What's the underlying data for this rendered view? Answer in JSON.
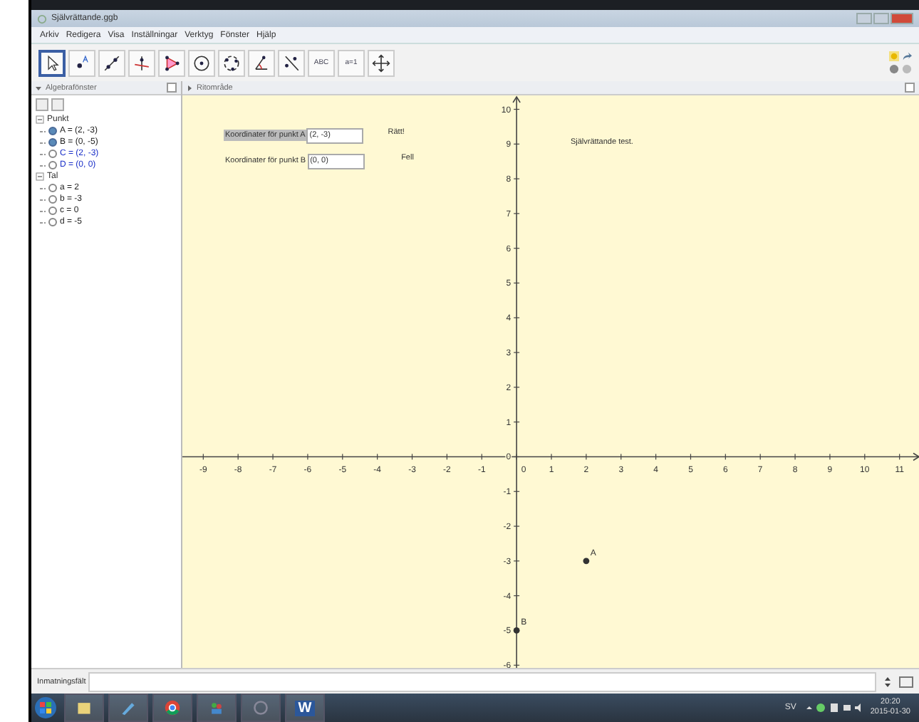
{
  "window": {
    "title": "Självrättande.ggb"
  },
  "menu": [
    "Arkiv",
    "Redigera",
    "Visa",
    "Inställningar",
    "Verktyg",
    "Fönster",
    "Hjälp"
  ],
  "tools": [
    {
      "kind": "pointer",
      "selected": true
    },
    {
      "kind": "point",
      "selected": false
    },
    {
      "kind": "line",
      "selected": false
    },
    {
      "kind": "perpendicular",
      "selected": false
    },
    {
      "kind": "polygon",
      "selected": false
    },
    {
      "kind": "circle",
      "selected": false
    },
    {
      "kind": "circle3",
      "selected": false
    },
    {
      "kind": "angle",
      "selected": false
    },
    {
      "kind": "reflect",
      "selected": false
    },
    {
      "kind": "text",
      "label": "ABC",
      "selected": false
    },
    {
      "kind": "slider",
      "label": "a=1",
      "selected": false
    },
    {
      "kind": "move",
      "selected": false
    }
  ],
  "algebra": {
    "title": "Algebrafönster",
    "groups": [
      {
        "name": "Punkt",
        "expanded": true,
        "children": [
          {
            "text": "A = (2, -3)",
            "visible": true,
            "dependent": false
          },
          {
            "text": "B = (0, -5)",
            "visible": true,
            "dependent": false
          },
          {
            "text": "C = (2, -3)",
            "visible": false,
            "dependent": true
          },
          {
            "text": "D = (0, 0)",
            "visible": false,
            "dependent": true
          }
        ]
      },
      {
        "name": "Tal",
        "expanded": true,
        "children": [
          {
            "text": "a = 2",
            "visible": false,
            "dependent": false
          },
          {
            "text": "b = -3",
            "visible": false,
            "dependent": false
          },
          {
            "text": "c = 0",
            "visible": false,
            "dependent": false
          },
          {
            "text": "d = -5",
            "visible": false,
            "dependent": false
          }
        ]
      }
    ]
  },
  "graphics": {
    "title": "Ritområde",
    "inputs": [
      {
        "label": "Koordinater för punkt A",
        "value": "(2, -3)",
        "highlighted": true,
        "feedback": "Rätt!"
      },
      {
        "label": "Koordinater för punkt B",
        "value": "(0, 0)",
        "highlighted": false,
        "feedback": "Fell"
      }
    ],
    "text": "Självrättande test.",
    "chart_data": {
      "type": "scatter",
      "x": [
        2,
        0
      ],
      "series": [
        {
          "color": "#333333",
          "values": [
            -3,
            -5
          ]
        }
      ],
      "xlim": [
        -9.6,
        11.6
      ],
      "ylim": [
        -6.2,
        10.4
      ],
      "xticks": [
        -9,
        -8,
        -7,
        -6,
        -5,
        -4,
        -3,
        -2,
        -1,
        0,
        1,
        2,
        3,
        4,
        5,
        6,
        7,
        8,
        9,
        10,
        11
      ],
      "yticks": [
        -6,
        -5,
        -4,
        -3,
        -2,
        -1,
        0,
        1,
        2,
        3,
        4,
        5,
        6,
        7,
        8,
        9,
        10
      ],
      "annotations": [
        {
          "x": 2,
          "y": -3,
          "text": "A"
        },
        {
          "x": 0,
          "y": -5,
          "text": "B"
        }
      ]
    }
  },
  "input_bar": {
    "label": "Inmatningsfält"
  },
  "taskbar": {
    "apps": [
      {
        "kind": "start"
      },
      {
        "kind": "explorer"
      },
      {
        "kind": "paint"
      },
      {
        "kind": "chrome"
      },
      {
        "kind": "people"
      },
      {
        "kind": "geogebra"
      },
      {
        "kind": "word"
      }
    ],
    "word_label": "W",
    "language": "SV",
    "time": "20:20",
    "date": "2015-01-30"
  }
}
